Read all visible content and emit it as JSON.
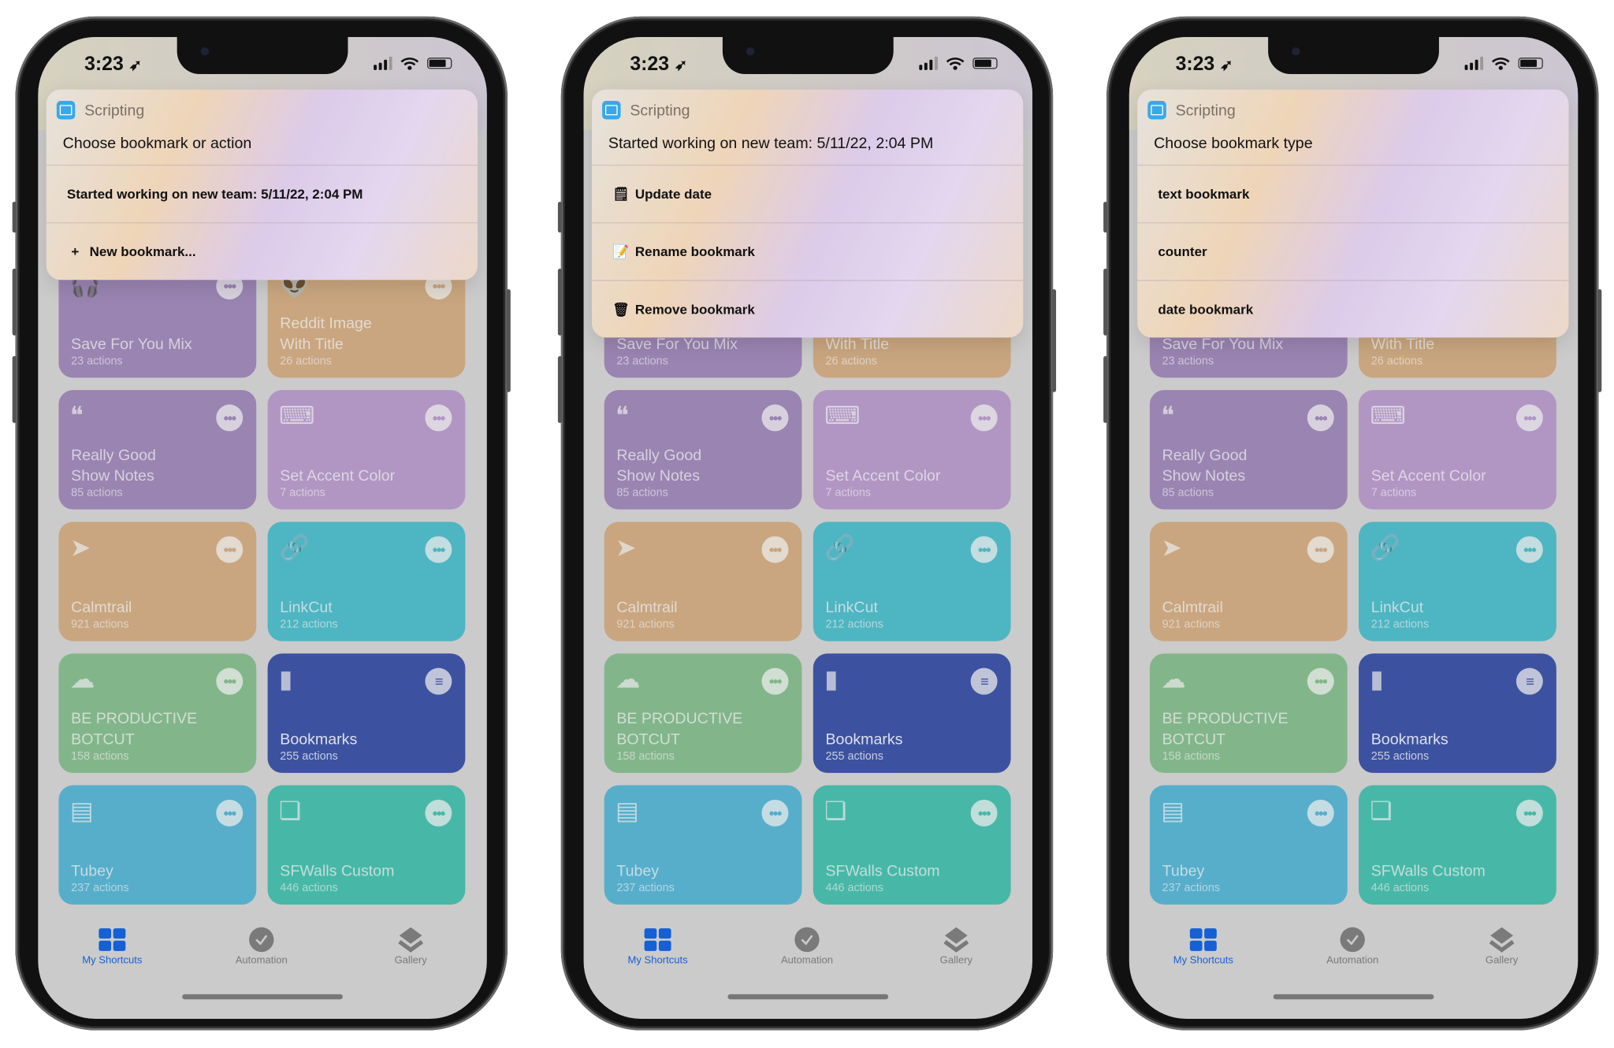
{
  "colors": {
    "accent": "#1560d4",
    "screen_dim": "#cbcbcb"
  },
  "phones": [
    {
      "time": "3:23",
      "notification": {
        "app": "Scripting",
        "title": "Choose bookmark or action",
        "items": [
          {
            "icon": "",
            "label": "Started working on new team: 5/11/22, 2:04 PM"
          },
          {
            "icon": "plus-icon",
            "glyph": "+",
            "label": "New bookmark..."
          }
        ]
      }
    },
    {
      "time": "3:23",
      "notification": {
        "app": "Scripting",
        "title": "Started working on new team: 5/11/22, 2:04 PM",
        "items": [
          {
            "icon": "notepad-icon",
            "glyph": "🗒",
            "label": "Update date"
          },
          {
            "icon": "pencil-memo-icon",
            "glyph": "📝",
            "label": "Rename bookmark"
          },
          {
            "icon": "trash-icon",
            "glyph": "🗑",
            "label": "Remove bookmark"
          }
        ]
      }
    },
    {
      "time": "3:23",
      "notification": {
        "app": "Scripting",
        "title": "Choose bookmark type",
        "items": [
          {
            "icon": "",
            "label": "text bookmark"
          },
          {
            "icon": "",
            "label": "counter"
          },
          {
            "icon": "",
            "label": "date bookmark"
          }
        ]
      }
    }
  ],
  "shortcuts": [
    {
      "title": "Save For You Mix",
      "count": "23 actions",
      "icon": "headphones-icon",
      "glyph": "🎧",
      "color": "#9a84b2"
    },
    {
      "title": "Reddit Image\nWith Title",
      "count": "26 actions",
      "icon": "alien-icon",
      "glyph": "👽",
      "color": "#c9a67f"
    },
    {
      "title": "Really Good\nShow Notes",
      "count": "85 actions",
      "icon": "quote-bubble-icon",
      "glyph": "❝",
      "color": "#9a84b2"
    },
    {
      "title": "Set Accent Color",
      "count": "7 actions",
      "icon": "laptop-icon",
      "glyph": "⌨",
      "color": "#b196c4"
    },
    {
      "title": "Calmtrail",
      "count": "921 actions",
      "icon": "location-arrow-icon",
      "glyph": "➤",
      "color": "#c9a67f"
    },
    {
      "title": "LinkCut",
      "count": "212 actions",
      "icon": "link-icon",
      "glyph": "🔗",
      "color": "#4eb5c2"
    },
    {
      "title": "BE PRODUCTIVE\nBOTCUT",
      "count": "158 actions",
      "icon": "brain-icon",
      "glyph": "☁",
      "color": "#82b68a"
    },
    {
      "title": "Bookmarks",
      "count": "255 actions",
      "icon": "book-icon",
      "glyph": "▮",
      "color": "#3c52a0",
      "action": "chat-bubble-icon"
    },
    {
      "title": "Tubey",
      "count": "237 actions",
      "icon": "film-icon",
      "glyph": "▤",
      "color": "#56aecb"
    },
    {
      "title": "SFWalls Custom",
      "count": "446 actions",
      "icon": "photos-stack-icon",
      "glyph": "❏",
      "color": "#47b8a7"
    }
  ],
  "tabs": [
    {
      "label": "My Shortcuts",
      "icon": "grid-icon",
      "active": true
    },
    {
      "label": "Automation",
      "icon": "clock-check-icon",
      "active": false
    },
    {
      "label": "Gallery",
      "icon": "layers-icon",
      "active": false
    }
  ]
}
